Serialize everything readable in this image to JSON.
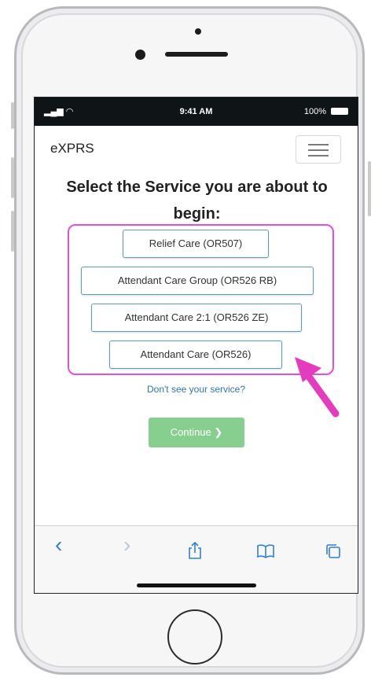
{
  "status_bar": {
    "signal": "▂▄▆ ◠",
    "time": "9:41 AM",
    "battery": "100%"
  },
  "header": {
    "brand": "eXPRS",
    "menu_icon": "hamburger-icon"
  },
  "page": {
    "heading": "Select the Service you are about to begin:",
    "services": [
      "Relief Care (OR507)",
      "Attendant Care Group (OR526 RB)",
      "Attendant Care 2:1 (OR526 ZE)",
      "Attendant Care (OR526)"
    ],
    "dont_see_link": "Don't see your service?",
    "continue_label": "Continue ❯"
  },
  "toolbar": {
    "back": "‹",
    "forward": "›",
    "share_icon": "share-icon",
    "bookmarks_icon": "bookmarks-icon",
    "tabs_icon": "tabs-icon"
  },
  "colors": {
    "highlight": "#e64ddb",
    "arrow": "#e53bbf",
    "continue_bg": "#86cf8f",
    "link": "#2f76b3",
    "toolbar_icon": "#2f80d8"
  }
}
